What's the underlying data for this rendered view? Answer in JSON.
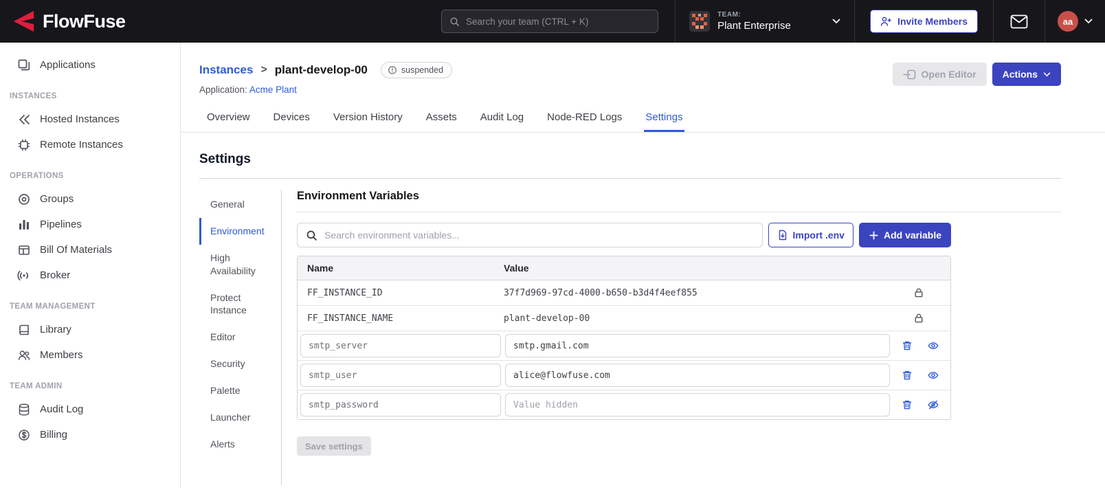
{
  "navbar": {
    "brand": "FlowFuse",
    "search_placeholder": "Search your team (CTRL + K)",
    "team_label": "TEAM:",
    "team_name": "Plant Enterprise",
    "invite_label": "Invite Members",
    "avatar": "aa"
  },
  "sidebar": {
    "sections": [
      {
        "label": "",
        "items": [
          {
            "label": "Applications",
            "icon": "applications-icon"
          }
        ]
      },
      {
        "label": "INSTANCES",
        "items": [
          {
            "label": "Hosted Instances",
            "icon": "hosted-instances-icon"
          },
          {
            "label": "Remote Instances",
            "icon": "remote-instances-icon"
          }
        ]
      },
      {
        "label": "OPERATIONS",
        "items": [
          {
            "label": "Groups",
            "icon": "groups-icon"
          },
          {
            "label": "Pipelines",
            "icon": "pipelines-icon"
          },
          {
            "label": "Bill Of Materials",
            "icon": "bill-of-materials-icon"
          },
          {
            "label": "Broker",
            "icon": "broker-icon"
          }
        ]
      },
      {
        "label": "TEAM MANAGEMENT",
        "items": [
          {
            "label": "Library",
            "icon": "library-icon"
          },
          {
            "label": "Members",
            "icon": "members-icon"
          }
        ]
      },
      {
        "label": "TEAM ADMIN",
        "items": [
          {
            "label": "Audit Log",
            "icon": "audit-log-icon"
          },
          {
            "label": "Billing",
            "icon": "billing-icon"
          }
        ]
      }
    ]
  },
  "page": {
    "breadcrumb_parent": "Instances",
    "separator": ">",
    "instance_name": "plant-develop-00",
    "status_badge": "suspended",
    "application_label": "Application:",
    "application_name": "Acme Plant",
    "open_editor_label": "Open Editor",
    "actions_label": "Actions"
  },
  "tabs": [
    "Overview",
    "Devices",
    "Version History",
    "Assets",
    "Audit Log",
    "Node-RED Logs",
    "Settings"
  ],
  "settings": {
    "title": "Settings",
    "nav": [
      "General",
      "Environment",
      "High Availability",
      "Protect Instance",
      "Editor",
      "Security",
      "Palette",
      "Launcher",
      "Alerts"
    ],
    "env": {
      "title": "Environment Variables",
      "search_placeholder": "Search environment variables...",
      "import_label": "Import .env",
      "add_label": "Add variable",
      "columns": [
        "Name",
        "Value"
      ],
      "locked_rows": [
        {
          "name": "FF_INSTANCE_ID",
          "value": "37f7d969-97cd-4000-b650-b3d4f4eef855"
        },
        {
          "name": "FF_INSTANCE_NAME",
          "value": "plant-develop-00"
        }
      ],
      "editable_rows": [
        {
          "name": "smtp_server",
          "value": "smtp.gmail.com"
        },
        {
          "name": "smtp_user",
          "value": "alice@flowfuse.com"
        },
        {
          "name": "smtp_password",
          "value": "",
          "value_placeholder": "Value hidden"
        }
      ],
      "save_label": "Save settings"
    }
  }
}
